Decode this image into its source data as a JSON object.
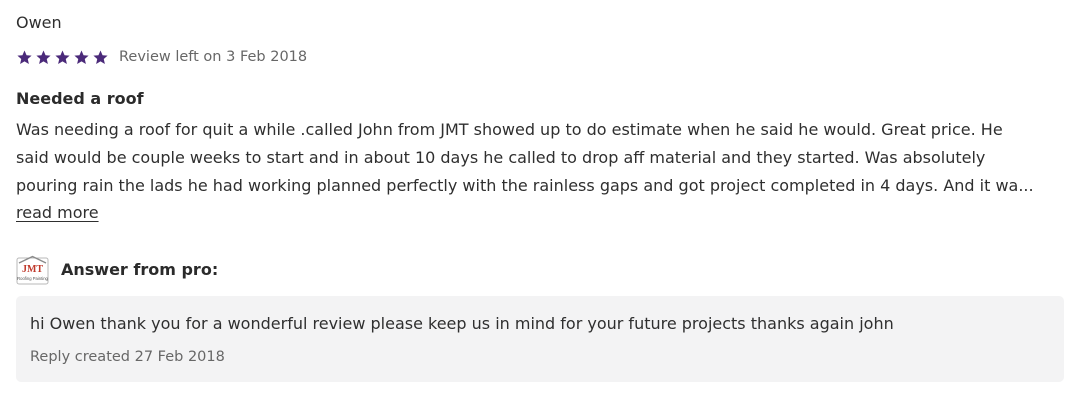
{
  "review": {
    "reviewer_name": "Owen",
    "rating": 5,
    "rating_max": 5,
    "star_color": "#4b2a7a",
    "date_text": "Review left on 3 Feb 2018",
    "title": "Needed a roof",
    "body_lines": [
      "Was needing a roof for quit a while .called John from JMT showed up to do estimate when he said he would. Great price. He",
      "said would be couple weeks to start and in about 10 days he called to drop aff material and they started. Was absolutely",
      "pouring rain the lads he had working planned perfectly with the rainless gaps and got project completed in 4 days. And it wa..."
    ],
    "read_more_label": "read more"
  },
  "pro_answer": {
    "logo_text": "JMT",
    "logo_subtext": "Roofing Painting",
    "header_label": "Answer from pro:",
    "reply_text": "hi Owen thank you for a wonderful review please keep us in mind for your future projects thanks again john",
    "reply_date_text": "Reply created 27 Feb 2018",
    "box_color": "#f3f3f4"
  }
}
